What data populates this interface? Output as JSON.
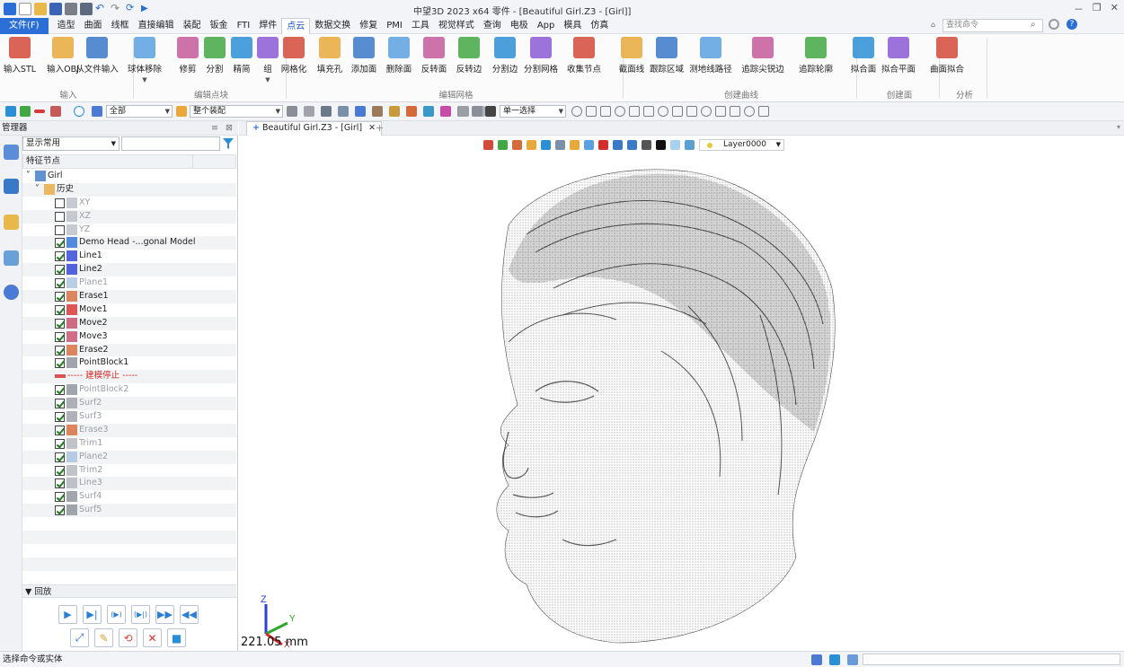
{
  "titlebar": {
    "title": "中望3D 2023 x64      零件 - [Beautiful Girl.Z3 - [Girl]]",
    "quick_icons": [
      "app-logo-icon",
      "new-file-icon",
      "open-folder-icon",
      "save-icon",
      "print-icon",
      "print-preview-icon",
      "undo-icon",
      "redo-icon",
      "refresh-icon",
      "run-icon"
    ],
    "window_controls": [
      "－",
      "❐",
      "✕"
    ]
  },
  "menubar": {
    "file": "文件(F)",
    "items": [
      "造型",
      "曲面",
      "线框",
      "直接编辑",
      "装配",
      "钣金",
      "FTI",
      "焊件",
      "点云",
      "数据交换",
      "修复",
      "PMI",
      "工具",
      "视觉样式",
      "查询",
      "电极",
      "App",
      "模具",
      "仿真"
    ],
    "active_index": 8,
    "search_placeholder": "查找命令"
  },
  "ribbon": {
    "groups": [
      {
        "label": "输入",
        "buttons": [
          {
            "label": "输入STL",
            "icon": "import-stl-icon"
          },
          {
            "label": "输入OBJ",
            "icon": "import-obj-icon"
          },
          {
            "label": "从文件输入",
            "icon": "import-file-icon"
          }
        ]
      },
      {
        "label": "编辑点块",
        "buttons": [
          {
            "label": "球体移除",
            "icon": "sphere-remove-icon"
          },
          {
            "label": "修剪",
            "icon": "trim-points-icon"
          },
          {
            "label": "分割",
            "icon": "split-points-icon"
          },
          {
            "label": "精简",
            "icon": "simplify-points-icon"
          },
          {
            "label": "组",
            "icon": "group-points-icon"
          }
        ]
      },
      {
        "label": "编辑网格",
        "buttons": [
          {
            "label": "网格化",
            "icon": "meshing-icon"
          },
          {
            "label": "填充孔",
            "icon": "fill-hole-icon"
          },
          {
            "label": "添加面",
            "icon": "add-face-icon"
          },
          {
            "label": "删除面",
            "icon": "delete-face-icon"
          },
          {
            "label": "反转面",
            "icon": "flip-face-icon"
          },
          {
            "label": "反转边",
            "icon": "flip-edge-icon"
          },
          {
            "label": "分割边",
            "icon": "split-edge-icon"
          },
          {
            "label": "分割网格",
            "icon": "split-mesh-icon"
          },
          {
            "label": "收集节点",
            "icon": "collect-nodes-icon"
          }
        ]
      },
      {
        "label": "创建曲线",
        "buttons": [
          {
            "label": "截面线",
            "icon": "section-line-icon"
          },
          {
            "label": "跟踪区域",
            "icon": "track-region-icon"
          },
          {
            "label": "测地线路径",
            "icon": "geodesic-path-icon"
          },
          {
            "label": "追踪尖锐边",
            "icon": "track-sharp-edge-icon"
          },
          {
            "label": "追踪轮廓",
            "icon": "track-contour-icon"
          }
        ]
      },
      {
        "label": "创建面",
        "buttons": [
          {
            "label": "拟合面",
            "icon": "fit-surface-icon"
          },
          {
            "label": "拟合平面",
            "icon": "fit-plane-icon"
          }
        ]
      },
      {
        "label": "分析",
        "buttons": [
          {
            "label": "曲面拟合",
            "icon": "surface-fit-analysis-icon"
          }
        ]
      }
    ]
  },
  "toolbar2": {
    "filter_value": "全部",
    "assembly_value": "整个装配",
    "select_mode": "单一选择"
  },
  "manager": {
    "title": "管理器",
    "filter_combo": "显示常用",
    "column_header": "特征节点",
    "tree": [
      {
        "label": "Girl",
        "indent": 0,
        "expander": "˅",
        "checkbox": false,
        "icon": "part-icon",
        "style": "normal"
      },
      {
        "label": "历史",
        "indent": 1,
        "expander": "˅",
        "checkbox": false,
        "icon": "history-folder-icon",
        "style": "normal"
      },
      {
        "label": "XY",
        "indent": 2,
        "checkbox": true,
        "checked": false,
        "icon": "datum-plane-icon",
        "style": "grey"
      },
      {
        "label": "XZ",
        "indent": 2,
        "checkbox": true,
        "checked": false,
        "icon": "datum-plane-icon",
        "style": "grey"
      },
      {
        "label": "YZ",
        "indent": 2,
        "checkbox": true,
        "checked": false,
        "icon": "datum-plane-icon",
        "style": "grey"
      },
      {
        "label": "Demo Head -...gonal Model",
        "indent": 2,
        "checkbox": true,
        "checked": true,
        "icon": "mesh-body-icon",
        "style": "normal"
      },
      {
        "label": "Line1",
        "indent": 2,
        "checkbox": true,
        "checked": true,
        "icon": "curve-icon",
        "style": "normal"
      },
      {
        "label": "Line2",
        "indent": 2,
        "checkbox": true,
        "checked": true,
        "icon": "curve-icon",
        "style": "normal"
      },
      {
        "label": "Plane1",
        "indent": 2,
        "checkbox": true,
        "checked": true,
        "icon": "plane-feature-icon",
        "style": "grey"
      },
      {
        "label": "Erase1",
        "indent": 2,
        "checkbox": true,
        "checked": true,
        "icon": "erase-icon",
        "style": "normal"
      },
      {
        "label": "Move1",
        "indent": 2,
        "checkbox": true,
        "checked": true,
        "icon": "move-icon",
        "style": "normal"
      },
      {
        "label": "Move2",
        "indent": 2,
        "checkbox": true,
        "checked": true,
        "icon": "move-alt-icon",
        "style": "normal"
      },
      {
        "label": "Move3",
        "indent": 2,
        "checkbox": true,
        "checked": true,
        "icon": "move-alt-icon",
        "style": "normal"
      },
      {
        "label": "Erase2",
        "indent": 2,
        "checkbox": true,
        "checked": true,
        "icon": "erase-icon",
        "style": "normal"
      },
      {
        "label": "PointBlock1",
        "indent": 2,
        "checkbox": true,
        "checked": true,
        "icon": "point-block-icon",
        "style": "normal"
      },
      {
        "label": "----- 建模停止 -----",
        "indent": 2,
        "checkbox": false,
        "icon": "rollback-arrow-icon",
        "style": "red"
      },
      {
        "label": "PointBlock2",
        "indent": 2,
        "checkbox": true,
        "checked": true,
        "icon": "point-block-icon",
        "style": "grey"
      },
      {
        "label": "Surf2",
        "indent": 2,
        "checkbox": true,
        "checked": true,
        "icon": "surface-icon",
        "style": "grey"
      },
      {
        "label": "Surf3",
        "indent": 2,
        "checkbox": true,
        "checked": true,
        "icon": "surface-icon",
        "style": "grey"
      },
      {
        "label": "Erase3",
        "indent": 2,
        "checkbox": true,
        "checked": true,
        "icon": "erase-icon",
        "style": "grey"
      },
      {
        "label": "Trim1",
        "indent": 2,
        "checkbox": true,
        "checked": true,
        "icon": "trim-icon",
        "style": "grey"
      },
      {
        "label": "Plane2",
        "indent": 2,
        "checkbox": true,
        "checked": true,
        "icon": "plane-feature-icon",
        "style": "grey"
      },
      {
        "label": "Trim2",
        "indent": 2,
        "checkbox": true,
        "checked": true,
        "icon": "trim-icon",
        "style": "grey"
      },
      {
        "label": "Line3",
        "indent": 2,
        "checkbox": true,
        "checked": true,
        "icon": "line-icon",
        "style": "grey"
      },
      {
        "label": "Surf4",
        "indent": 2,
        "checkbox": true,
        "checked": true,
        "icon": "surface-patch-icon",
        "style": "grey"
      },
      {
        "label": "Surf5",
        "indent": 2,
        "checkbox": true,
        "checked": true,
        "icon": "surface-patch-icon",
        "style": "grey"
      }
    ],
    "playback_title": "回放",
    "playback_buttons": [
      "play-icon",
      "step-to-end-icon",
      "step-forward-icon",
      "step-back-icon",
      "fast-forward-icon",
      "rewind-icon"
    ],
    "playback_tools": [
      "link-icon",
      "edit-pencil-icon",
      "rebuild-icon",
      "delete-icon",
      "panel-icon"
    ]
  },
  "viewport": {
    "tab_label": "Beautiful Girl.Z3 - [Girl]",
    "layer": "Layer0000",
    "scale_text": "221.05 mm",
    "triad_labels": {
      "z": "Z",
      "y": "Y",
      "x": "X"
    }
  },
  "status": {
    "text": "选择命令或实体"
  },
  "colors": {
    "accent": "#2b6fd6",
    "red_text": "#d42b2b",
    "grey_text": "#9a9ea5"
  }
}
